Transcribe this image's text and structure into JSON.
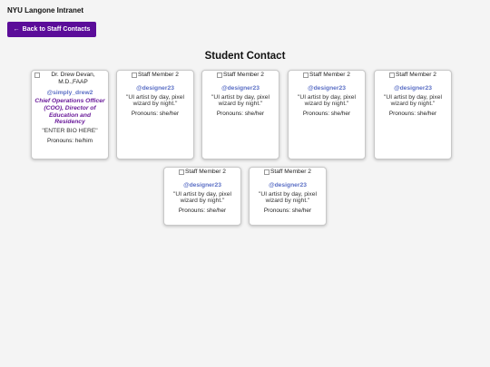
{
  "site": {
    "title": "NYU Langone Intranet"
  },
  "nav": {
    "back_arrow": "←",
    "back_label": "Back to Staff Contacts"
  },
  "page": {
    "heading": "Student Contact"
  },
  "colors": {
    "accent": "#5b0d99",
    "handle": "#5b6fc5",
    "role": "#6a1b9a"
  },
  "contacts": [
    {
      "image_alt": "Dr. Drew Devan, M.D.,FAAP",
      "handle": "@simply_drew2",
      "role": "Chief Operations Officer (COO), Director of Education and Residency",
      "bio": "\"ENTER BIO HERE\"",
      "pronouns": "Pronouns: he/him"
    },
    {
      "image_alt": "Staff Member 2",
      "handle": "@designer23",
      "bio": "\"UI artist by day, pixel wizard by night.\"",
      "pronouns": "Pronouns: she/her"
    },
    {
      "image_alt": "Staff Member 2",
      "handle": "@designer23",
      "bio": "\"UI artist by day, pixel wizard by night.\"",
      "pronouns": "Pronouns: she/her"
    },
    {
      "image_alt": "Staff Member 2",
      "handle": "@designer23",
      "bio": "\"UI artist by day, pixel wizard by night.\"",
      "pronouns": "Pronouns: she/her"
    },
    {
      "image_alt": "Staff Member 2",
      "handle": "@designer23",
      "bio": "\"UI artist by day, pixel wizard by night.\"",
      "pronouns": "Pronouns: she/her"
    },
    {
      "image_alt": "Staff Member 2",
      "handle": "@designer23",
      "bio": "\"UI artist by day, pixel wizard by night.\"",
      "pronouns": "Pronouns: she/her"
    },
    {
      "image_alt": "Staff Member 2",
      "handle": "@designer23",
      "bio": "\"UI artist by day, pixel wizard by night.\"",
      "pronouns": "Pronouns: she/her"
    }
  ]
}
